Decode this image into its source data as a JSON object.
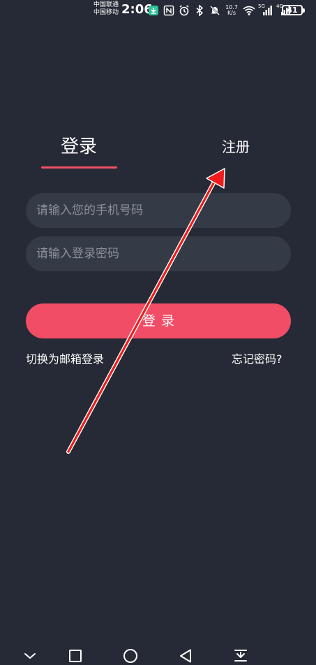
{
  "status_bar": {
    "carrier_1": "中国联通",
    "carrier_2": "中国移动",
    "time": "2:06",
    "network_speed_value": "10.7",
    "network_speed_unit": "K/s",
    "network_type_1": "5G",
    "network_type_2": "4G",
    "battery": "41",
    "icons": [
      "download-notification-icon",
      "nfc-icon",
      "alarm-icon",
      "bluetooth-icon",
      "mute-icon",
      "wifi-icon",
      "signal-icon",
      "battery-icon"
    ]
  },
  "tabs": {
    "login": "登录",
    "register": "注册",
    "active": "login"
  },
  "form": {
    "phone_placeholder": "请输入您的手机号码",
    "password_placeholder": "请输入登录密码",
    "login_button": "登录"
  },
  "links": {
    "switch_email": "切换为邮箱登录",
    "forgot_password": "忘记密码?"
  },
  "colors": {
    "background": "#262a36",
    "accent": "#f24d66",
    "input_bg": "#353a47",
    "placeholder": "#8a8f9c",
    "annotation_arrow": "#ee1c1c"
  },
  "nav_bar": {
    "icons": [
      "chevron-down-icon",
      "recent-apps-icon",
      "home-icon",
      "back-icon",
      "notification-pull-icon"
    ]
  }
}
